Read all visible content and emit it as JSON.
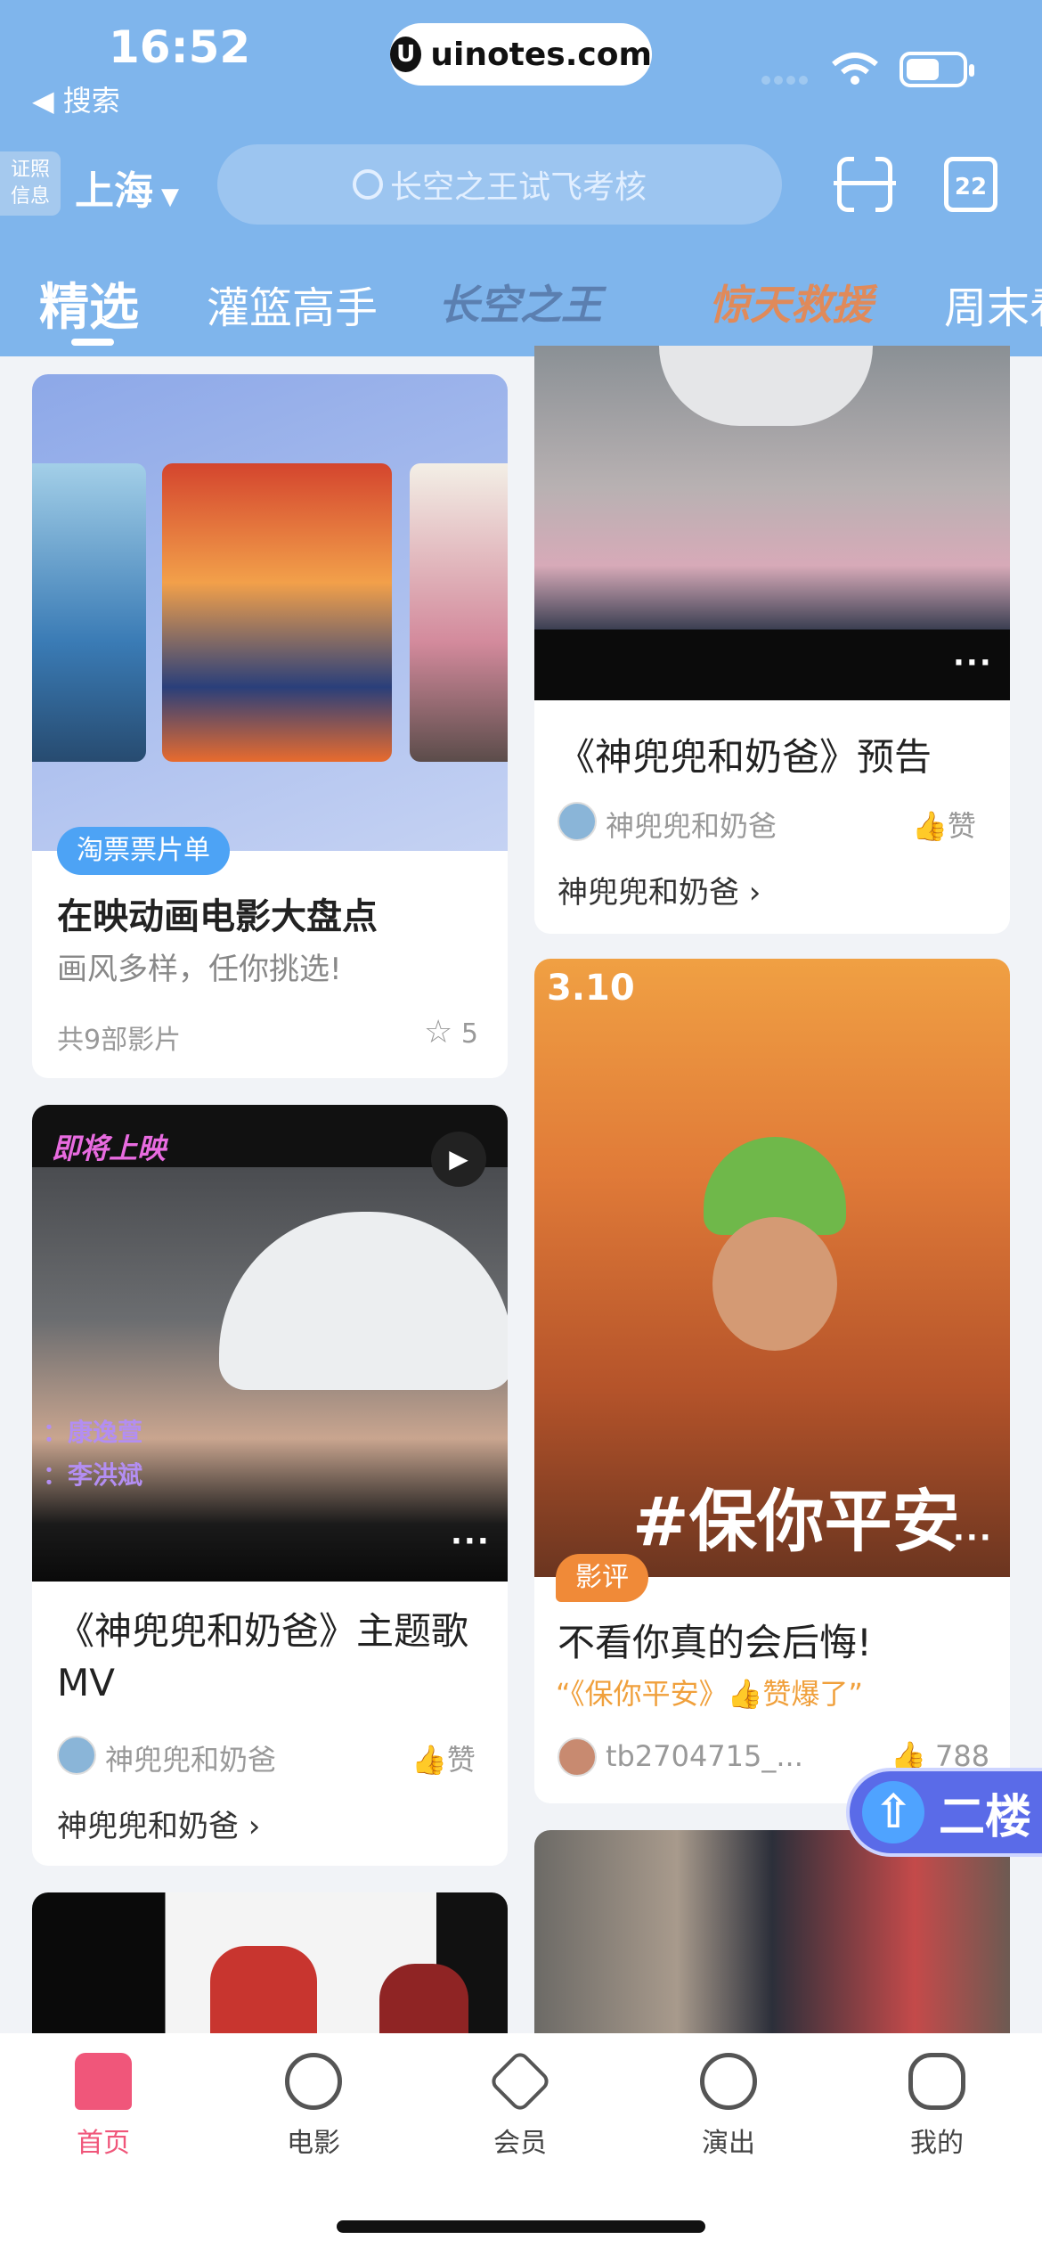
{
  "status": {
    "time": "16:52",
    "back_label": "◀ 搜索",
    "url": "uinotes.com"
  },
  "header": {
    "cert_label_1": "证照",
    "cert_label_2": "信息",
    "city": "上海",
    "search_placeholder": "长空之王试飞考核",
    "calendar_day": "22"
  },
  "tabs": [
    {
      "label": "精选"
    },
    {
      "label": "灌篮高手"
    },
    {
      "label": "长空之王"
    },
    {
      "label": "惊天救援"
    },
    {
      "label": "周末看"
    }
  ],
  "feed": {
    "card1": {
      "tag": "淘票票片单",
      "title": "在映动画电影大盘点",
      "subtitle": "画风多样，任你挑选!",
      "count": "共9部影片",
      "stars": "5"
    },
    "card2": {
      "badge": "即将上映",
      "title": "《神兜兜和奶爸》主题歌MV",
      "author": "神兜兜和奶爸",
      "like": "赞",
      "link": "神兜兜和奶爸 ›",
      "overlay_1": "：康逸萱",
      "overlay_2": "：李洪斌"
    },
    "card3": {
      "title": "《神兜兜和奶爸》预告",
      "author": "神兜兜和奶爸",
      "like": "赞",
      "link": "神兜兜和奶爸 ›"
    },
    "card4": {
      "tag": "影评",
      "title": "不看你真的会后悔!",
      "quote": "“《保你平安》👍赞爆了”",
      "author": "tb2704715_...",
      "likes": "788",
      "poster_title": "#保你平安",
      "poster_date": "3.10"
    }
  },
  "floor_button": "二楼",
  "bottom_nav": [
    {
      "label": "首页"
    },
    {
      "label": "电影"
    },
    {
      "label": "会员"
    },
    {
      "label": "演出"
    },
    {
      "label": "我的"
    }
  ]
}
